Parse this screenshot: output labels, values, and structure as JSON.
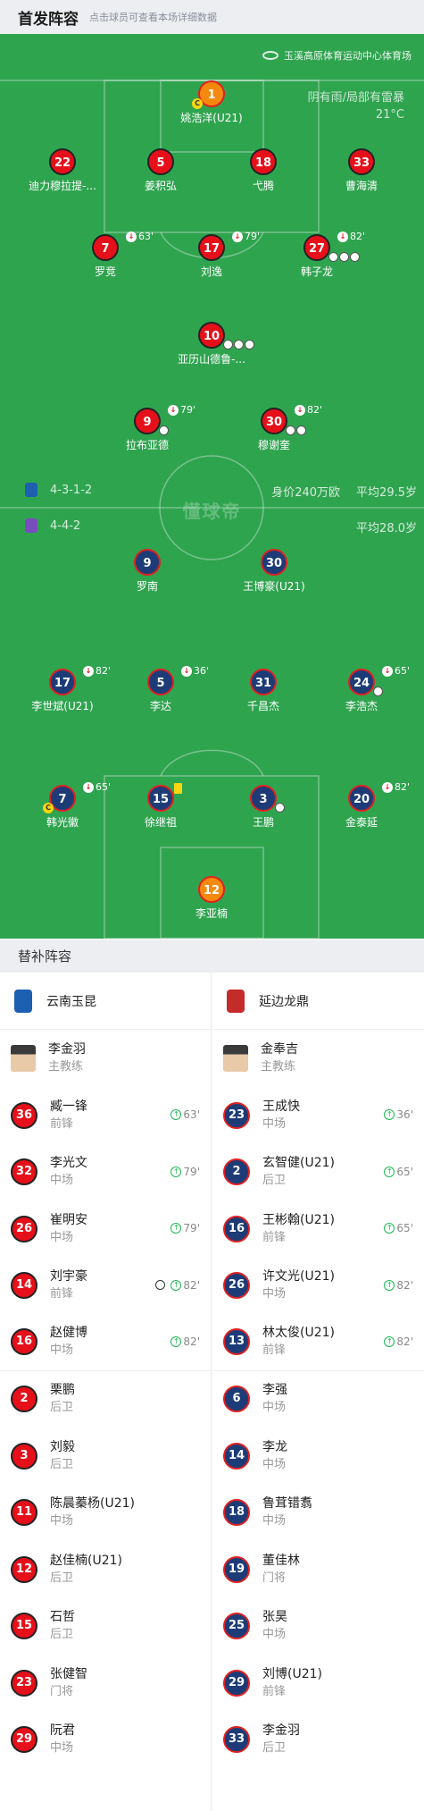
{
  "header": {
    "title": "首发阵容",
    "hint": "点击球员可查看本场详细数据"
  },
  "venue": {
    "name": "玉溪高原体育运动中心体育场",
    "weather": "阴有雨/局部有雷暴",
    "temperature": "21°C"
  },
  "pitch_watermark": "懂球帝",
  "home": {
    "formation": "4-3-1-2",
    "value": "身价240万欧",
    "avg_age": "平均29.5岁",
    "players": [
      {
        "num": "1",
        "name": "姚浩洋(U21)",
        "gk": true,
        "captain": true
      },
      {
        "num": "22",
        "name": "迪力穆拉提-..."
      },
      {
        "num": "5",
        "name": "姜积弘"
      },
      {
        "num": "18",
        "name": "弋腾"
      },
      {
        "num": "33",
        "name": "曹海清"
      },
      {
        "num": "7",
        "name": "罗竞",
        "sub": "63'"
      },
      {
        "num": "17",
        "name": "刘逸",
        "sub": "79'"
      },
      {
        "num": "27",
        "name": "韩子龙",
        "sub": "82'"
      },
      {
        "num": "10",
        "name": "亚历山德鲁-..."
      },
      {
        "num": "9",
        "name": "拉布亚德",
        "sub": "79'"
      },
      {
        "num": "30",
        "name": "穆谢奎",
        "sub": "82'"
      }
    ]
  },
  "away": {
    "formation": "4-4-2",
    "avg_age": "平均28.0岁",
    "players": [
      {
        "num": "9",
        "name": "罗南"
      },
      {
        "num": "30",
        "name": "王博豪(U21)"
      },
      {
        "num": "17",
        "name": "李世斌(U21)",
        "sub": "82'"
      },
      {
        "num": "5",
        "name": "李达",
        "sub": "36'"
      },
      {
        "num": "31",
        "name": "千昌杰"
      },
      {
        "num": "24",
        "name": "李浩杰",
        "sub": "65'"
      },
      {
        "num": "7",
        "name": "韩光徽",
        "sub": "65'",
        "captain": true
      },
      {
        "num": "15",
        "name": "徐继祖"
      },
      {
        "num": "3",
        "name": "王鹏"
      },
      {
        "num": "20",
        "name": "金泰延",
        "sub": "82'"
      },
      {
        "num": "12",
        "name": "李亚楠",
        "gk": true
      }
    ]
  },
  "subs": {
    "title": "替补阵容",
    "left": {
      "team": "云南玉昆",
      "coach": {
        "name": "李金羽",
        "role": "主教练"
      },
      "players": [
        {
          "num": "36",
          "name": "臧一锋",
          "pos": "前锋",
          "sub": "63'"
        },
        {
          "num": "32",
          "name": "李光文",
          "pos": "中场",
          "sub": "79'"
        },
        {
          "num": "26",
          "name": "崔明安",
          "pos": "中场",
          "sub": "79'"
        },
        {
          "num": "14",
          "name": "刘宇豪",
          "pos": "前锋",
          "sub": "82'",
          "goal": true
        },
        {
          "num": "16",
          "name": "赵健博",
          "pos": "中场",
          "sub": "82'"
        },
        {
          "num": "2",
          "name": "栗鹏",
          "pos": "后卫"
        },
        {
          "num": "3",
          "name": "刘毅",
          "pos": "后卫"
        },
        {
          "num": "11",
          "name": "陈晨蓁杨(U21)",
          "pos": "中场"
        },
        {
          "num": "12",
          "name": "赵佳楠(U21)",
          "pos": "后卫"
        },
        {
          "num": "15",
          "name": "石哲",
          "pos": "后卫"
        },
        {
          "num": "23",
          "name": "张健智",
          "pos": "门将"
        },
        {
          "num": "29",
          "name": "阮君",
          "pos": "中场"
        }
      ]
    },
    "right": {
      "team": "延边龙鼎",
      "coach": {
        "name": "金奉吉",
        "role": "主教练"
      },
      "players": [
        {
          "num": "23",
          "name": "王成快",
          "pos": "中场",
          "sub": "36'"
        },
        {
          "num": "2",
          "name": "玄智健(U21)",
          "pos": "后卫",
          "sub": "65'"
        },
        {
          "num": "16",
          "name": "王彬翰(U21)",
          "pos": "前锋",
          "sub": "65'"
        },
        {
          "num": "26",
          "name": "许文光(U21)",
          "pos": "中场",
          "sub": "82'"
        },
        {
          "num": "13",
          "name": "林太俊(U21)",
          "pos": "前锋",
          "sub": "82'"
        },
        {
          "num": "6",
          "name": "李强",
          "pos": "中场"
        },
        {
          "num": "14",
          "name": "李龙",
          "pos": "中场"
        },
        {
          "num": "18",
          "name": "鲁茸错翥",
          "pos": "中场"
        },
        {
          "num": "19",
          "name": "董佳林",
          "pos": "门将"
        },
        {
          "num": "25",
          "name": "张昊",
          "pos": "中场"
        },
        {
          "num": "29",
          "name": "刘博(U21)",
          "pos": "前锋"
        },
        {
          "num": "33",
          "name": "李金羽",
          "pos": "后卫"
        }
      ]
    }
  },
  "colors": {
    "pitch": "#2fa44f",
    "home": "#e5101a",
    "away": "#1d3c77",
    "gk": "#f5890e",
    "sub_in": "#1db954"
  }
}
